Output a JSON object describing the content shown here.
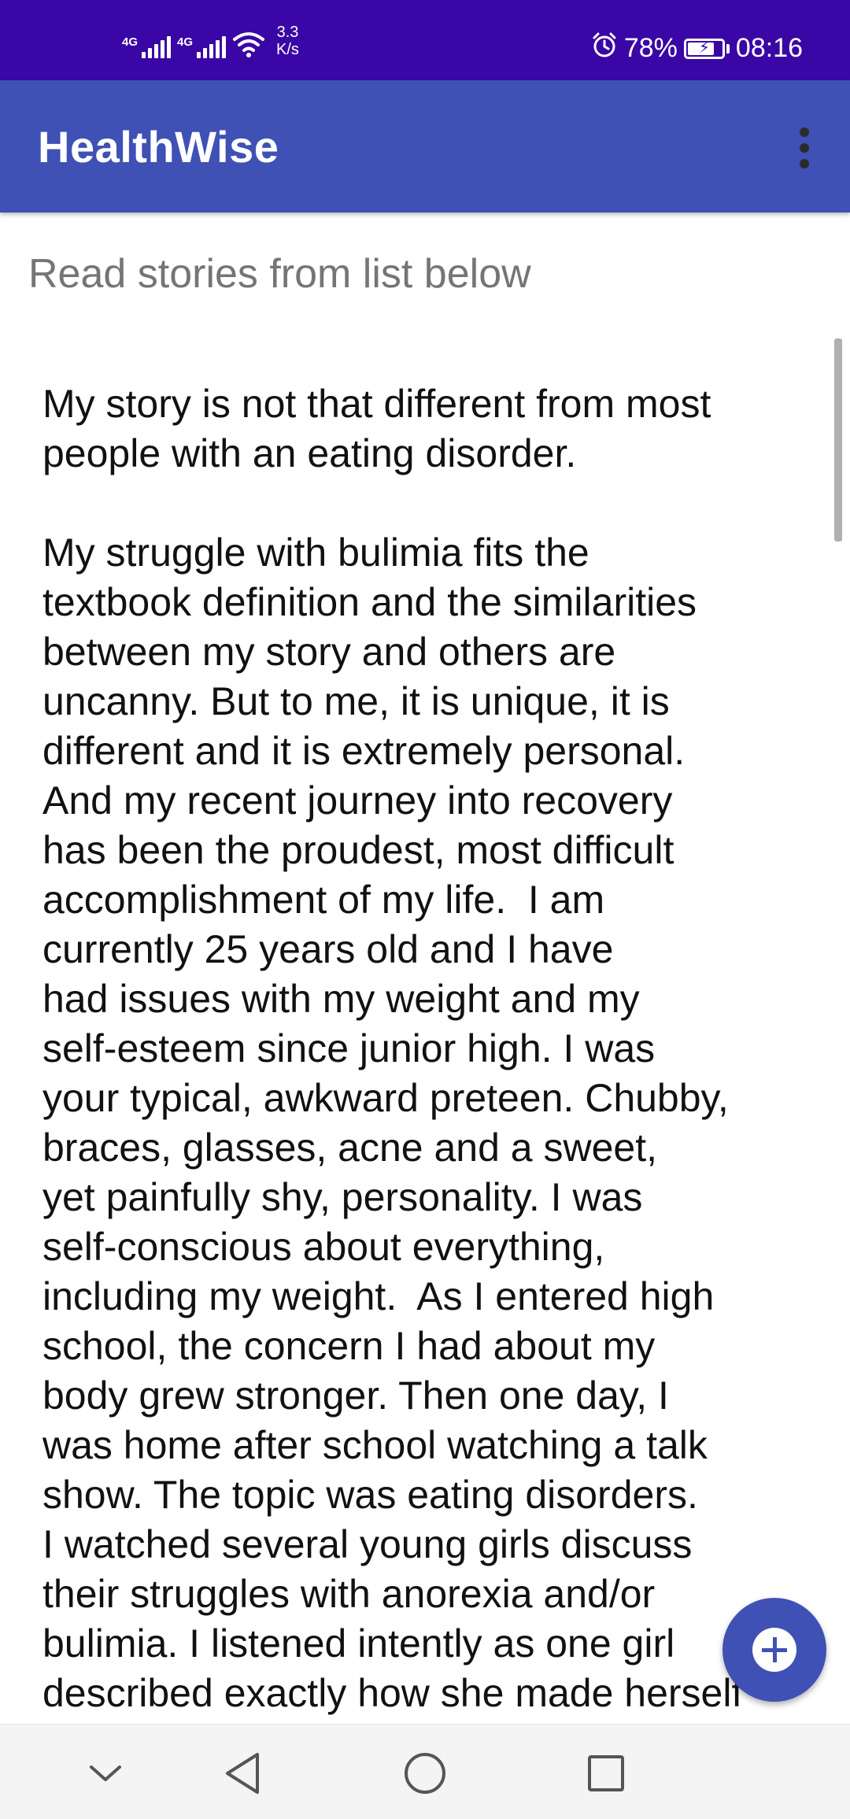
{
  "status_bar": {
    "sim1": "4G",
    "sim2": "4G",
    "net_speed_value": "3.3",
    "net_speed_unit": "K/s",
    "battery_percent": "78%",
    "battery_level": 0.78,
    "time": "08:16",
    "icons": [
      "signal-icon",
      "signal-icon",
      "wifi-icon",
      "alarm-icon",
      "battery-icon"
    ]
  },
  "app_bar": {
    "title": "HealthWise",
    "menu_icon": "more-vert-icon"
  },
  "subtitle": "Read stories from list below",
  "story": {
    "text": "My story is not that different from most\npeople with an eating disorder.\n\nMy struggle with bulimia fits the\ntextbook definition and the similarities\nbetween my story and others are\nuncanny. But to me, it is unique, it is\ndifferent and it is extremely personal.\nAnd my recent journey into recovery\nhas been the proudest, most difficult\naccomplishment of my life.  I am\ncurrently 25 years old and I have\nhad issues with my weight and my\nself-esteem since junior high. I was\nyour typical, awkward preteen. Chubby,\nbraces, glasses, acne and a sweet,\nyet painfully shy, personality. I was\nself-conscious about everything,\nincluding my weight.  As I entered high\nschool, the concern I had about my\nbody grew stronger. Then one day, I\nwas home after school watching a talk\nshow. The topic was eating disorders.\nI watched several young girls discuss\ntheir struggles with anorexia and/or\nbulimia. I listened intently as one girl\ndescribed exactly how she made herself"
  },
  "fab": {
    "icon": "add-circle-icon"
  },
  "nav_bar": {
    "icons": [
      "chevron-down-icon",
      "back-icon",
      "home-icon",
      "recents-icon"
    ]
  }
}
